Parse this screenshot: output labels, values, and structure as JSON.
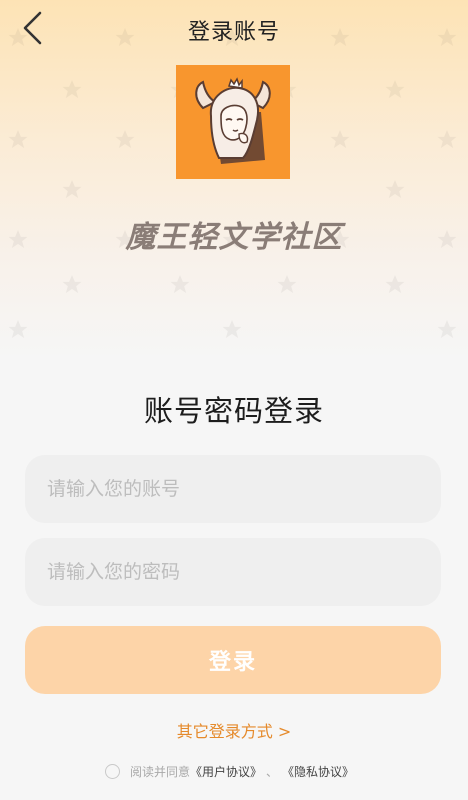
{
  "header": {
    "back_icon": "chevron-left-icon",
    "title": "登录账号"
  },
  "logo": {
    "icon": "mascot-logo",
    "brand_name": "魔王轻文学社区",
    "bg_color": "#f8962e"
  },
  "login_form": {
    "section_title": "账号密码登录",
    "account": {
      "value": "",
      "placeholder": "请输入您的账号"
    },
    "password": {
      "value": "",
      "placeholder": "请输入您的密码"
    },
    "submit_label": "登录",
    "other_login_label": "其它登录方式 >"
  },
  "agreement": {
    "checked": false,
    "prefix": "阅读并同意",
    "user_agreement": "《用户协议》",
    "separator": "、",
    "privacy_policy": "《隐私协议》"
  },
  "colors": {
    "accent": "#e58a2b",
    "button_bg": "#fdd4a8",
    "input_bg": "#efefef",
    "header_gradient_top": "#fde3b5"
  }
}
